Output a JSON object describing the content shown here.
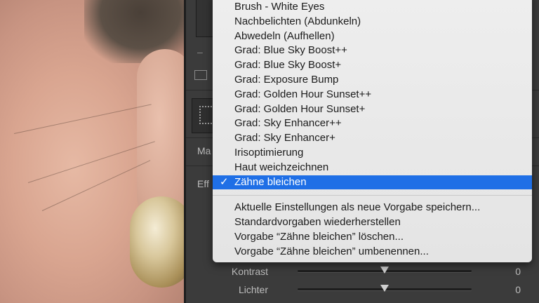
{
  "panel": {
    "label_fragment_masks": "Ma",
    "label_fragment_effect": "Eff"
  },
  "menu": {
    "presets": [
      {
        "label": "Brush - White Eyes",
        "selected": false
      },
      {
        "label": "Nachbelichten (Abdunkeln)",
        "selected": false
      },
      {
        "label": "Abwedeln (Aufhellen)",
        "selected": false
      },
      {
        "label": "Grad: Blue Sky Boost++",
        "selected": false
      },
      {
        "label": "Grad: Blue Sky Boost+",
        "selected": false
      },
      {
        "label": "Grad: Exposure Bump",
        "selected": false
      },
      {
        "label": "Grad: Golden Hour Sunset++",
        "selected": false
      },
      {
        "label": "Grad: Golden Hour Sunset+",
        "selected": false
      },
      {
        "label": "Grad: Sky Enhancer++",
        "selected": false
      },
      {
        "label": "Grad: Sky Enhancer+",
        "selected": false
      },
      {
        "label": "Irisoptimierung",
        "selected": false
      },
      {
        "label": "Haut weichzeichnen",
        "selected": false
      },
      {
        "label": "Zähne bleichen",
        "selected": true
      }
    ],
    "check_glyph": "✓",
    "actions": [
      "Aktuelle Einstellungen als neue Vorgabe speichern...",
      "Standardvorgaben wiederherstellen",
      "Vorgabe “Zähne bleichen” löschen...",
      "Vorgabe “Zähne bleichen” umbenennen..."
    ]
  },
  "sliders": [
    {
      "label": "Kontrast",
      "value": "0",
      "level": 0.5
    },
    {
      "label": "Lichter",
      "value": "0",
      "level": 0.5
    }
  ],
  "colors": {
    "selection": "#1f6fe6",
    "menu_bg": "#eeeeee",
    "panel_bg": "#3b3b3b"
  }
}
